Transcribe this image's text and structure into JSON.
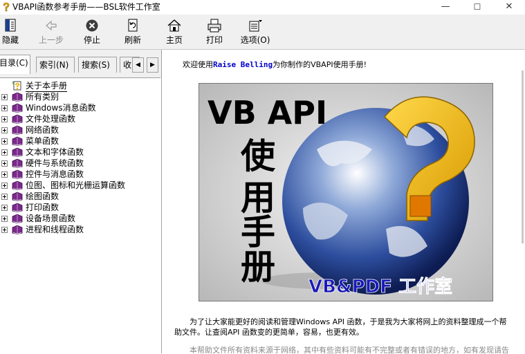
{
  "window": {
    "title": "VBAPI函数参考手册——BSL软件工作室",
    "minimize": "—",
    "maximize": "☐",
    "close": "✕"
  },
  "toolbar": {
    "hide": "隐藏",
    "back": "上一步",
    "stop": "停止",
    "refresh": "刷新",
    "home": "主页",
    "print": "打印",
    "options": "选项(O)"
  },
  "tabs": {
    "contents": "目录(C)",
    "index": "索引(N)",
    "search": "搜索(S)",
    "favorites": "收"
  },
  "tree": [
    "关于本手册",
    "所有类别",
    "Windows消息函数",
    "文件处理函数",
    "网络函数",
    "菜单函数",
    "文本和字体函数",
    "硬件与系统函数",
    "控件与消息函数",
    "位图、图标和光栅运算函数",
    "绘图函数",
    "打印函数",
    "设备场景函数",
    "进程和线程函数"
  ],
  "content": {
    "welcome_pre": "欢迎使用",
    "welcome_brand": "Raise Belling",
    "welcome_post": "为你制作的VBAPI使用手册!",
    "banner_title": "VB API",
    "banner_sub": [
      "使",
      "用",
      "手",
      "册"
    ],
    "banner_studio": "VB&PDF 工作室",
    "para1": "为了让大家能更好的阅读和管理Windows API 函数，于是我为大家将网上的资料整理成一个帮助文件。让查阅API 函数变的更简单，容易，也更有效。",
    "para2": "本帮助文件所有资料来源于网络，其中有些资料可能有不完整或者有错误的地方，如有发现请告之。"
  },
  "colors": {
    "brand_blue": "#0000cc",
    "studio_blue": "#1a1ab8",
    "question_gold": "#f0b400"
  }
}
